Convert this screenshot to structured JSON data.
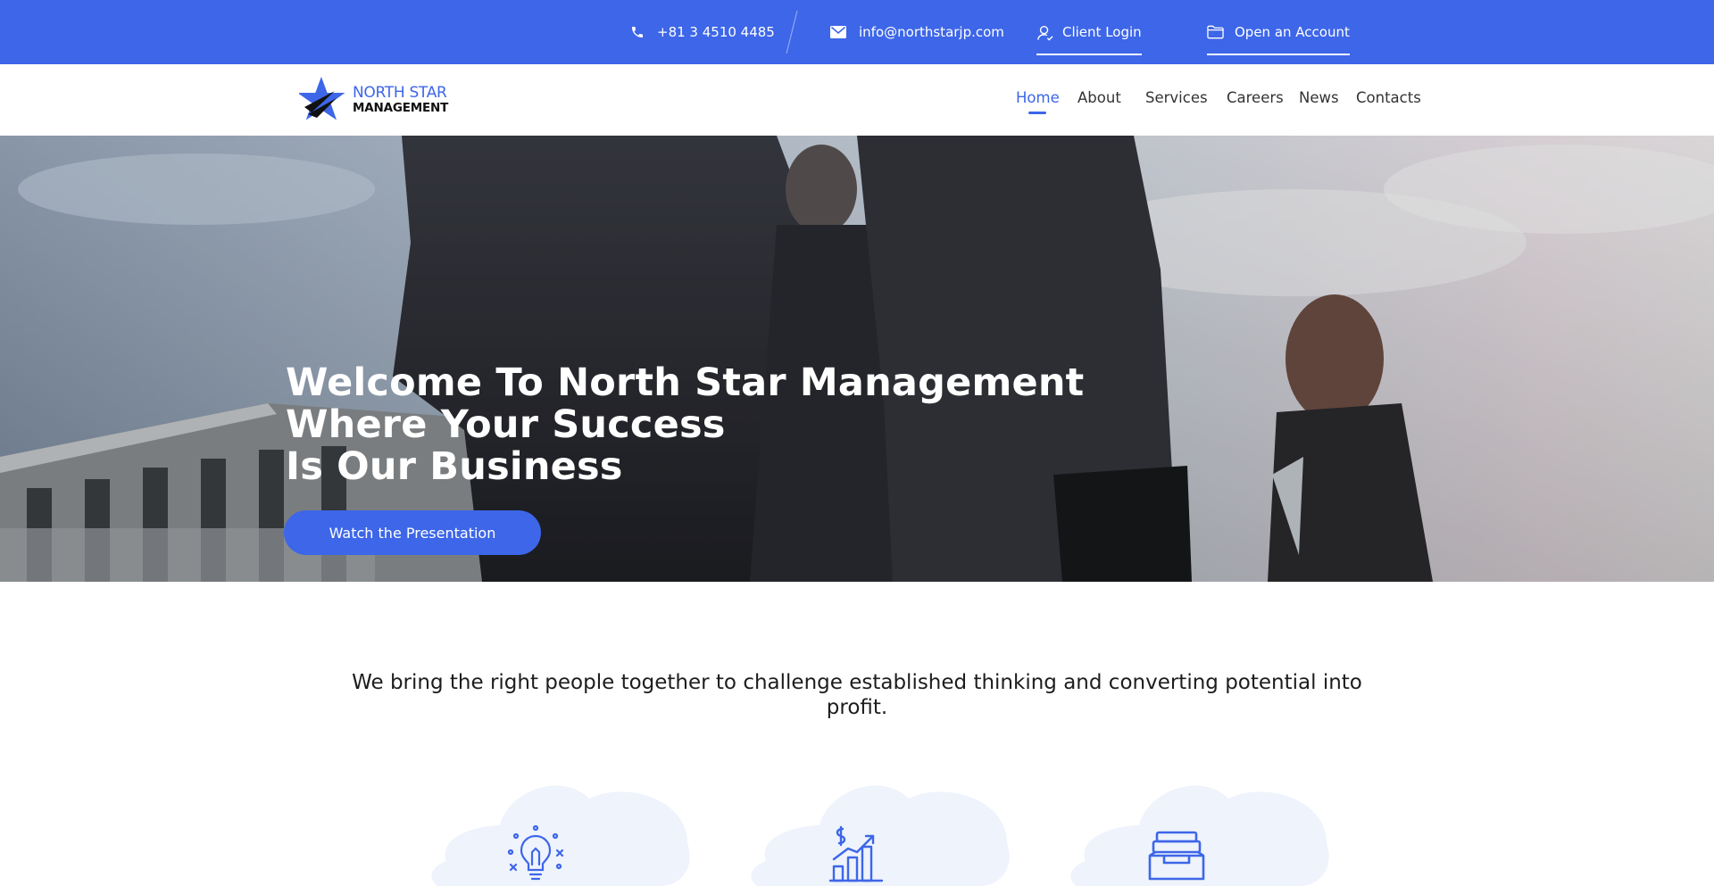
{
  "topbar": {
    "phone": "+81 3 4510 4485",
    "email": "info@northstarjp.com",
    "client_login": "Client Login",
    "open_account": "Open an Account",
    "phone_icon": "phone-icon",
    "email_icon": "envelope-icon",
    "client_icon": "user-icon",
    "account_icon": "folder-icon"
  },
  "logo": {
    "line1": "NORTH STAR",
    "line2": "MANAGEMENT"
  },
  "nav": {
    "items": [
      {
        "label": "Home",
        "active": true
      },
      {
        "label": "About",
        "active": false
      },
      {
        "label": "Services",
        "active": false
      },
      {
        "label": "Careers",
        "active": false
      },
      {
        "label": "News",
        "active": false
      },
      {
        "label": "Contacts",
        "active": false
      }
    ]
  },
  "hero": {
    "title_line1": "Welcome To North Star Management",
    "title_line2": "Where Your Success",
    "title_line3": "Is Our Business",
    "button_label": "Watch the Presentation"
  },
  "intro": {
    "text": "We bring the right people together to challenge established thinking and converting potential into profit."
  },
  "features": [
    {
      "icon": "lightbulb-icon"
    },
    {
      "icon": "growth-chart-icon"
    },
    {
      "icon": "inbox-tray-icon"
    }
  ],
  "colors": {
    "brand_blue": "#3d66e8",
    "blob": "#eef3fc"
  }
}
